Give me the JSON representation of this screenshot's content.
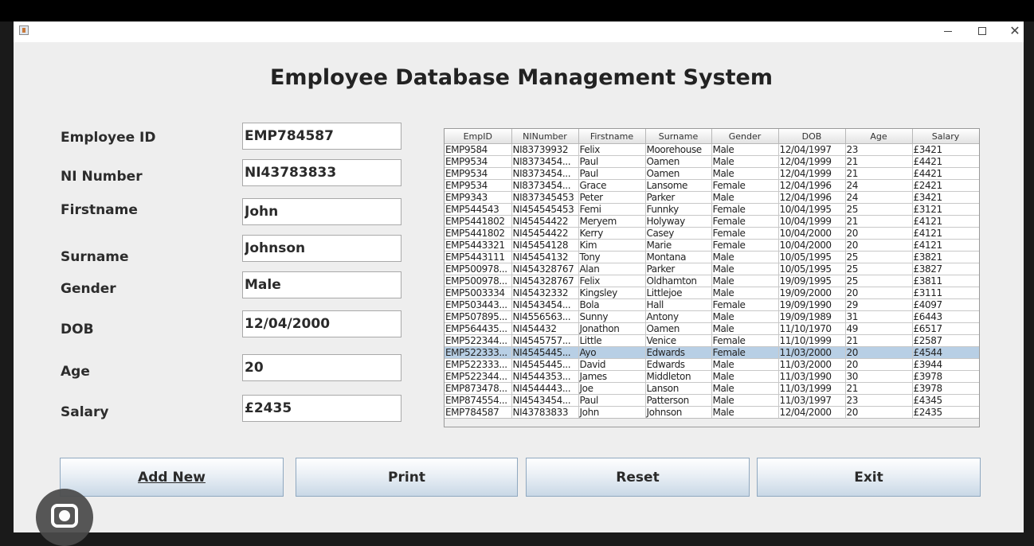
{
  "title": "Employee Database Management System",
  "form": {
    "fields": [
      {
        "label": "Employee ID",
        "value": "EMP784587"
      },
      {
        "label": "NI Number",
        "value": "NI43783833"
      },
      {
        "label": "Firstname",
        "value": "John"
      },
      {
        "label": "Surname",
        "value": "Johnson"
      },
      {
        "label": "Gender",
        "value": "Male"
      },
      {
        "label": "DOB",
        "value": "12/04/2000"
      },
      {
        "label": "Age",
        "value": "20"
      },
      {
        "label": "Salary",
        "value": "£2435"
      }
    ]
  },
  "table": {
    "columns": [
      "EmpID",
      "NINumber",
      "Firstname",
      "Surname",
      "Gender",
      "DOB",
      "Age",
      "Salary"
    ],
    "rows": [
      [
        "EMP9584",
        "NI83739932",
        "Felix",
        "Moorehouse",
        "Male",
        "12/04/1997",
        "23",
        "£3421"
      ],
      [
        "EMP9534",
        "NI8373454...",
        "Paul",
        "Oamen",
        "Male",
        "12/04/1999",
        "21",
        "£4421"
      ],
      [
        "EMP9534",
        "NI8373454...",
        "Paul",
        "Oamen",
        "Male",
        "12/04/1999",
        "21",
        "£4421"
      ],
      [
        "EMP9534",
        "NI8373454...",
        "Grace",
        "Lansome",
        "Female",
        "12/04/1996",
        "24",
        "£2421"
      ],
      [
        "EMP9343",
        "NI837345453",
        "Peter",
        "Parker",
        "Male",
        "12/04/1996",
        "24",
        "£3421"
      ],
      [
        "EMP544543",
        "NI454545453",
        "Femi",
        "Funnky",
        "Female",
        "10/04/1995",
        "25",
        "£3121"
      ],
      [
        "EMP5441802",
        "NI45454422",
        "Meryem",
        "Holyway",
        "Female",
        "10/04/1999",
        "21",
        "£4121"
      ],
      [
        "EMP5441802",
        "NI45454422",
        "Kerry",
        "Casey",
        "Female",
        "10/04/2000",
        "20",
        "£4121"
      ],
      [
        "EMP5443321",
        "NI45454128",
        "Kim",
        "Marie",
        "Female",
        "10/04/2000",
        "20",
        "£4121"
      ],
      [
        "EMP5443111",
        "NI45454132",
        "Tony",
        "Montana",
        "Male",
        "10/05/1995",
        "25",
        "£3821"
      ],
      [
        "EMP500978...",
        "NI454328767",
        "Alan",
        "Parker",
        "Male",
        "10/05/1995",
        "25",
        "£3827"
      ],
      [
        "EMP500978...",
        "NI454328767",
        "Felix",
        "Oldhamton",
        "Male",
        "19/09/1995",
        "25",
        "£3811"
      ],
      [
        "EMP5003334",
        "NI45432332",
        "Kingsley",
        "Littlejoe",
        "Male",
        "19/09/2000",
        "20",
        "£3111"
      ],
      [
        "EMP503443...",
        "NI4543454...",
        "Bola",
        "Hall",
        "Female",
        "19/09/1990",
        "29",
        "£4097"
      ],
      [
        "EMP507895...",
        "NI4556563...",
        "Sunny",
        "Antony",
        "Male",
        "19/09/1989",
        "31",
        "£6443"
      ],
      [
        "EMP564435...",
        "NI454432",
        "Jonathon",
        "Oamen",
        "Male",
        "11/10/1970",
        "49",
        "£6517"
      ],
      [
        "EMP522344...",
        "NI4545757...",
        "Little",
        "Venice",
        "Female",
        "11/10/1999",
        "21",
        "£2587"
      ],
      [
        "EMP522333...",
        "NI4545445...",
        "Ayo",
        "Edwards",
        "Female",
        "11/03/2000",
        "20",
        "£4544"
      ],
      [
        "EMP522333...",
        "NI4545445...",
        "David",
        "Edwards",
        "Male",
        "11/03/2000",
        "20",
        "£3944"
      ],
      [
        "EMP522344...",
        "NI4544353...",
        "James",
        "Middleton",
        "Male",
        "11/03/1990",
        "30",
        "£3978"
      ],
      [
        "EMP873478...",
        "NI4544443...",
        "Joe",
        "Lanson",
        "Male",
        "11/03/1999",
        "21",
        "£3978"
      ],
      [
        "EMP874554...",
        "NI4543454...",
        "Paul",
        "Patterson",
        "Male",
        "11/03/1997",
        "23",
        "£4345"
      ],
      [
        "EMP784587",
        "NI43783833",
        "John",
        "Johnson",
        "Male",
        "12/04/2000",
        "20",
        "£2435"
      ]
    ],
    "selected_row": 17
  },
  "buttons": {
    "add_new": "Add New",
    "print": "Print",
    "reset": "Reset",
    "exit": "Exit"
  },
  "icons": {
    "window_min": "minimize-icon",
    "window_max": "maximize-icon",
    "window_close": "close-icon",
    "lens": "google-lens-icon"
  },
  "colors": {
    "selection": "#b8cfe5",
    "window_bg": "#eeeeee",
    "button_border": "#8fa8c0"
  }
}
